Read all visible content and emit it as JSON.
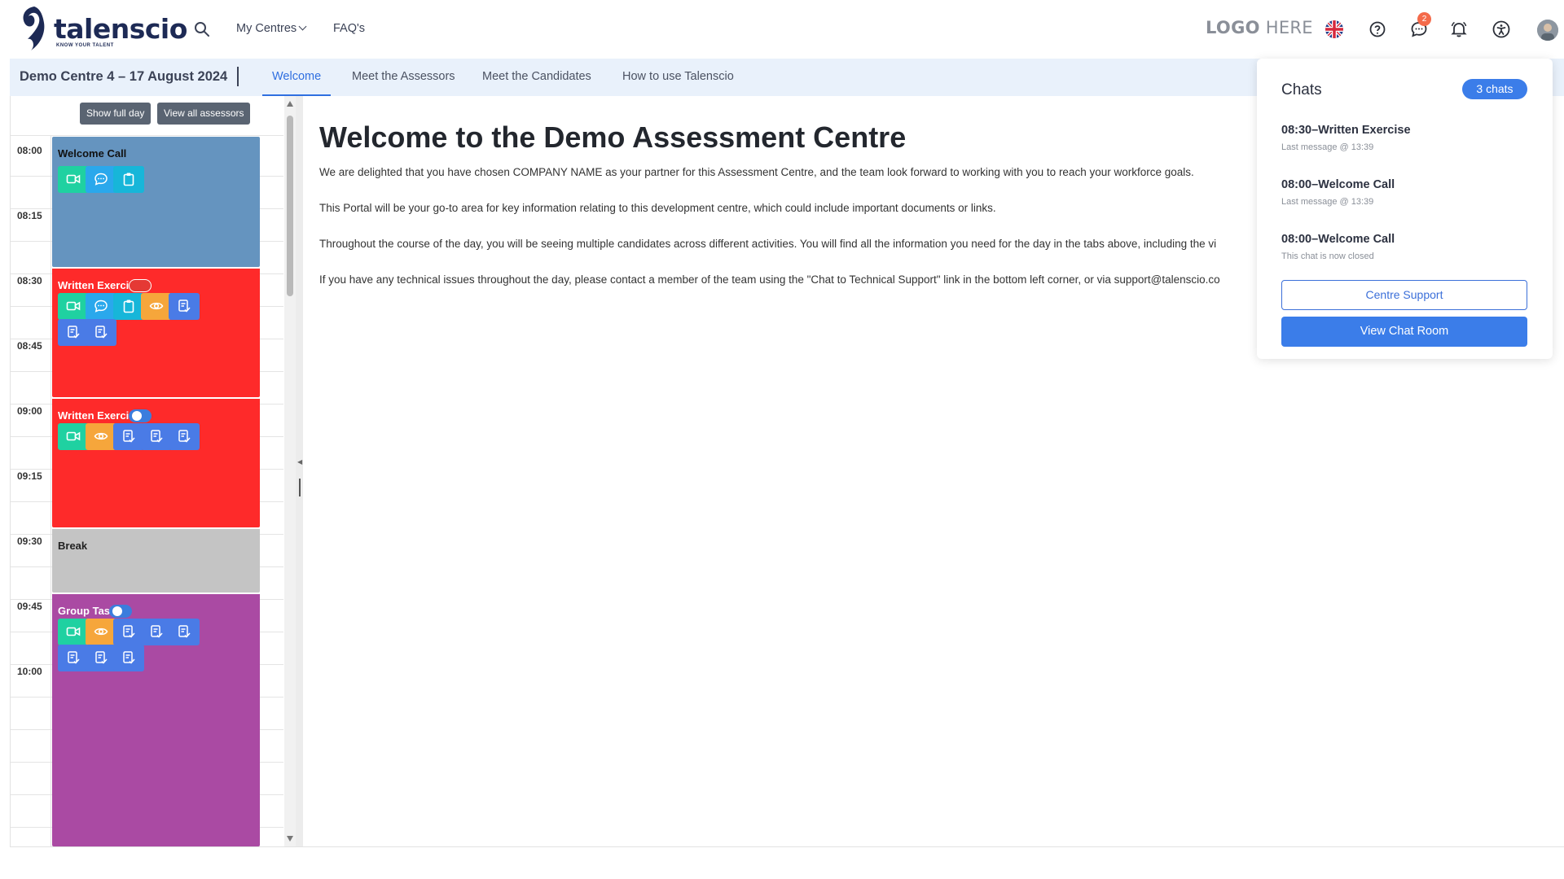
{
  "header": {
    "logo_word": "talenscio",
    "logo_tag": "KNOW YOUR TALENT",
    "nav": {
      "my_centres": "My Centres",
      "faqs": "FAQ's"
    },
    "client_logo": {
      "bold": "LOGO",
      "light": " HERE"
    },
    "chat_badge_count": "2",
    "icons": [
      "search-icon",
      "uk-flag-icon",
      "help-icon",
      "chat-icon",
      "bell-icon",
      "accessibility-icon",
      "avatar"
    ]
  },
  "subbar": {
    "centre_title": "Demo Centre 4 – 17 August 2024",
    "tabs": [
      {
        "label": "Welcome",
        "active": true
      },
      {
        "label": "Meet the Assessors",
        "active": false
      },
      {
        "label": "Meet the Candidates",
        "active": false
      },
      {
        "label": "How to use Talenscio",
        "active": false
      }
    ]
  },
  "schedule": {
    "show_full_day": "Show full day",
    "view_all_assessors": "View all assessors",
    "times": [
      "08:00",
      "08:15",
      "08:30",
      "08:45",
      "09:00",
      "09:15",
      "09:30",
      "09:45",
      "10:00"
    ],
    "events": [
      {
        "title": "Welcome Call",
        "color": "#6594bf",
        "toggle": null,
        "actions": [
          "video",
          "chat",
          "clipboard"
        ]
      },
      {
        "title": "Written Exercise",
        "color": "#fe2a2a",
        "toggle": "off",
        "actions": [
          "video",
          "chat",
          "clipboard",
          "eye",
          "doc",
          "doc",
          "doc"
        ]
      },
      {
        "title": "Written Exercise",
        "color": "#fe2a2a",
        "toggle": "on",
        "actions": [
          "video",
          "eye",
          "doc",
          "doc",
          "doc"
        ]
      },
      {
        "title": "Break",
        "color": "#c4c4c4",
        "toggle": null,
        "actions": []
      },
      {
        "title": "Group Task",
        "color": "#aa4aa3",
        "toggle": "on",
        "actions": [
          "video",
          "eye",
          "doc",
          "doc",
          "doc",
          "doc",
          "doc",
          "doc"
        ]
      }
    ]
  },
  "main": {
    "title": "Welcome to the Demo Assessment Centre",
    "paragraphs": [
      "We are delighted that you have chosen COMPANY NAME as your partner for this Assessment Centre, and the team look forward to working with you to reach your workforce goals.",
      "This Portal will be your go-to area for key information relating to this development centre, which could include important documents or links.",
      "Throughout the course of the day, you will be seeing multiple candidates across different activities. You will find all the information you need for the day in the tabs above, including the vi",
      "If you have any technical issues throughout the day, please contact a member of the team using the \"Chat to Technical Support\" link in the bottom left corner, or via support@talenscio.co"
    ]
  },
  "chats": {
    "title": "Chats",
    "count_label": "3 chats",
    "items": [
      {
        "name": "08:30–Written Exercise",
        "sub": "Last message @ 13:39"
      },
      {
        "name": "08:00–Welcome Call",
        "sub": "Last message @ 13:39"
      },
      {
        "name": "08:00–Welcome Call",
        "sub": "This chat is now closed"
      }
    ],
    "centre_support": "Centre Support",
    "view_chat_room": "View Chat Room"
  },
  "colors": {
    "accent": "#3b7de9",
    "nav_text": "#3b4256",
    "video": "#1fd1a1",
    "chat": "#2aa8ec",
    "eye": "#f6a63b",
    "doc": "#4a7be6"
  }
}
